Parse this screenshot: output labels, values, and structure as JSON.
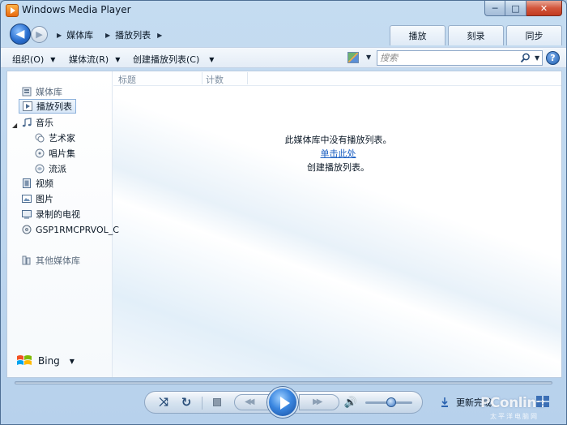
{
  "window": {
    "title": "Windows Media Player",
    "controls": {
      "minimize": "─",
      "maximize": "□",
      "close": "✕"
    }
  },
  "nav": {
    "back_glyph": "◀",
    "forward_glyph": "▶",
    "breadcrumb": [
      "媒体库",
      "播放列表"
    ],
    "tabs": [
      "播放",
      "刻录",
      "同步"
    ]
  },
  "toolbar": {
    "organize": "组织(O)",
    "stream": "媒体流(R)",
    "create_playlist": "创建播放列表(C)",
    "search_placeholder": "搜索",
    "help": "?"
  },
  "sidebar": {
    "items": [
      {
        "label": "媒体库",
        "icon": "library-icon"
      },
      {
        "label": "播放列表",
        "icon": "playlist-icon",
        "selected": true
      },
      {
        "label": "音乐",
        "icon": "music-icon"
      },
      {
        "label": "艺术家",
        "icon": "artist-icon"
      },
      {
        "label": "唱片集",
        "icon": "album-icon"
      },
      {
        "label": "流派",
        "icon": "genre-icon"
      },
      {
        "label": "视频",
        "icon": "video-icon"
      },
      {
        "label": "图片",
        "icon": "picture-icon"
      },
      {
        "label": "录制的电视",
        "icon": "tv-icon"
      },
      {
        "label": "GSP1RMCPRVOL_C",
        "icon": "disc-icon"
      },
      {
        "label": "其他媒体库",
        "icon": "other-libraries-icon"
      }
    ],
    "bing": "Bing"
  },
  "main": {
    "columns": [
      "标题",
      "计数"
    ],
    "empty_line1": "此媒体库中没有播放列表。",
    "empty_link": "单击此处",
    "empty_line3": "创建播放列表。"
  },
  "player": {
    "shuffle_glyph": "⤨",
    "repeat_glyph": "↻",
    "prev_glyph": "◀◀",
    "next_glyph": "▶▶",
    "volume_glyph": "🔊",
    "volume_level": 0.55
  },
  "status": {
    "text": "更新完成"
  },
  "watermark": {
    "brand": "PConline",
    "sub": "太平洋电脑网"
  }
}
